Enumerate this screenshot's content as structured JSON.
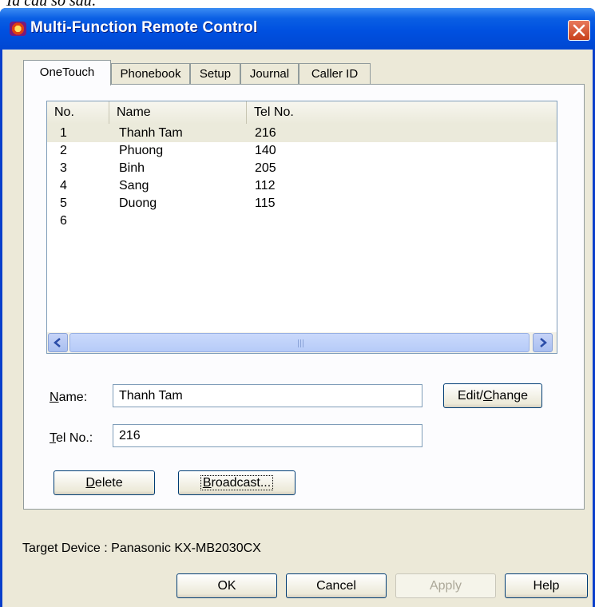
{
  "caption": "Ta cấu số sau:",
  "window": {
    "title": "Multi-Function Remote Control"
  },
  "tabs": [
    {
      "label": "OneTouch"
    },
    {
      "label": "Phonebook"
    },
    {
      "label": "Setup"
    },
    {
      "label": "Journal"
    },
    {
      "label": "Caller ID"
    }
  ],
  "list": {
    "columns": [
      "No.",
      "Name",
      "Tel No."
    ],
    "rows": [
      {
        "no": "1",
        "name": "Thanh Tam",
        "tel": "216"
      },
      {
        "no": "2",
        "name": "Phuong",
        "tel": "140"
      },
      {
        "no": "3",
        "name": "Binh",
        "tel": "205"
      },
      {
        "no": "4",
        "name": "Sang",
        "tel": "112"
      },
      {
        "no": "5",
        "name": "Duong",
        "tel": "115"
      },
      {
        "no": "6",
        "name": "",
        "tel": ""
      }
    ],
    "selected_index": 0
  },
  "form": {
    "name_label_key": "N",
    "name_label_rest": "ame:",
    "name_value": "Thanh Tam",
    "tel_label_key": "T",
    "tel_label_rest": "el No.:",
    "tel_value": "216",
    "edit_label_a": "Edit/",
    "edit_label_key": "C",
    "edit_label_b": "hange",
    "delete_key": "D",
    "delete_rest": "elete",
    "broadcast_key": "B",
    "broadcast_rest": "roadcast..."
  },
  "target_device": "Target Device : Panasonic KX-MB2030CX",
  "footer": {
    "ok": "OK",
    "cancel": "Cancel",
    "apply": "Apply",
    "help": "Help"
  },
  "colors": {
    "titlebar": "#0050e0",
    "face": "#ece9d8",
    "close": "#c8401a"
  }
}
